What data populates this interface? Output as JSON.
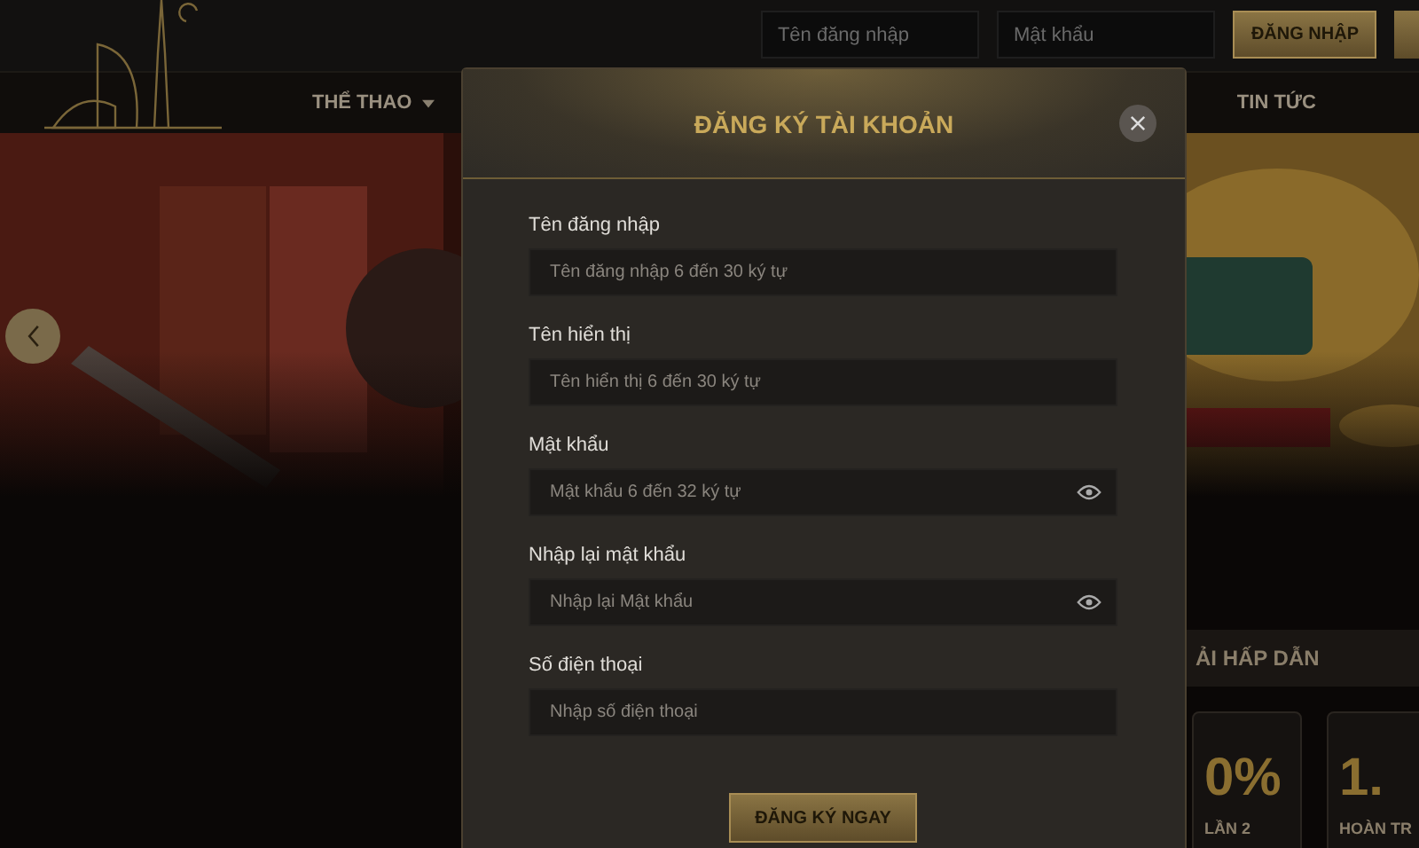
{
  "header": {
    "username_placeholder": "Tên đăng nhập",
    "password_placeholder": "Mật khẩu",
    "login_button": "ĐĂNG NHẬP"
  },
  "nav": [
    {
      "label": "THỂ THAO",
      "dropdown": true
    },
    {
      "label": "TIN TỨC",
      "dropdown": false
    }
  ],
  "section_title": "ẢI HẤP DẪN",
  "promo_cards": [
    {
      "value": "0%",
      "caption": "LẦN 2"
    },
    {
      "value": "1.",
      "caption": "HOÀN TR"
    }
  ],
  "modal": {
    "title": "ĐĂNG KÝ TÀI KHOẢN",
    "fields": [
      {
        "label": "Tên đăng nhập",
        "placeholder": "Tên đăng nhập 6 đến 30 ký tự",
        "kind": "text"
      },
      {
        "label": "Tên hiển thị",
        "placeholder": "Tên hiển thị 6 đến 30 ký tự",
        "kind": "text"
      },
      {
        "label": "Mật khẩu",
        "placeholder": "Mật khẩu 6 đến 32 ký tự",
        "kind": "password"
      },
      {
        "label": "Nhập lại mật khẩu",
        "placeholder": "Nhập lại Mật khẩu",
        "kind": "password"
      },
      {
        "label": "Số điện thoại",
        "placeholder": "Nhập số điện thoại",
        "kind": "text"
      }
    ],
    "submit": "ĐĂNG KÝ NGAY"
  }
}
